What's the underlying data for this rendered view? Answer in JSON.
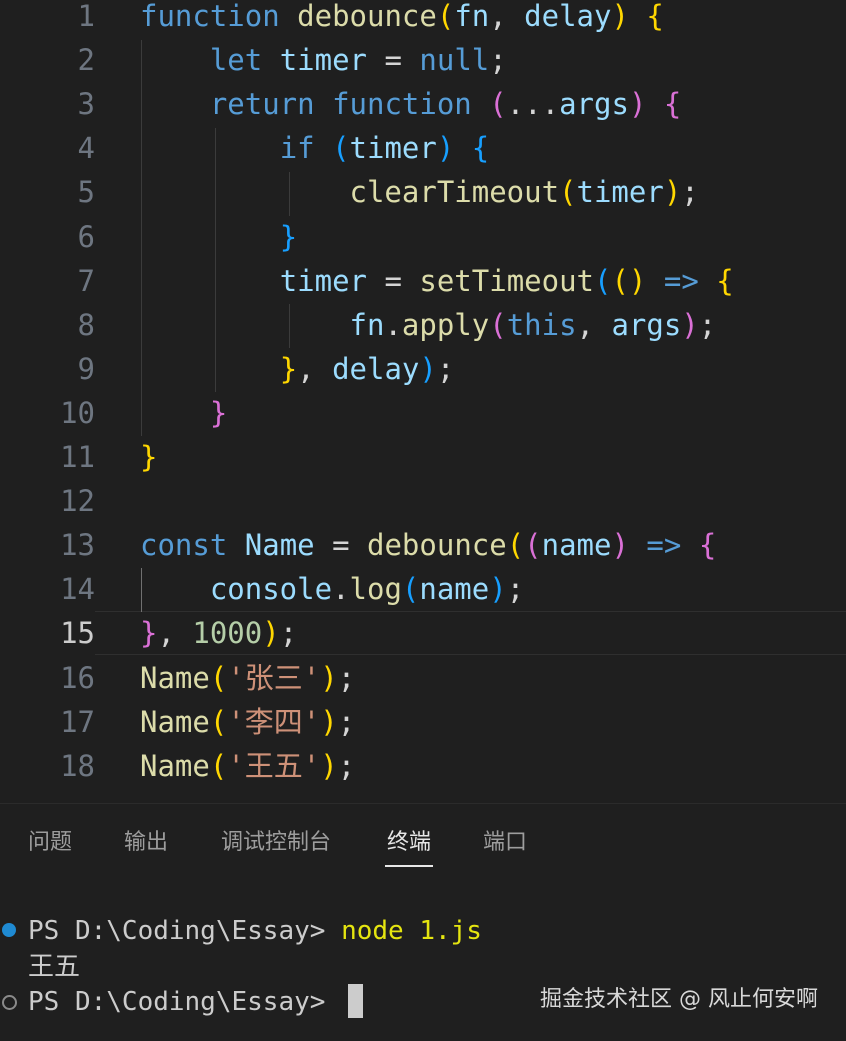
{
  "editor": {
    "line_numbers": [
      "1",
      "2",
      "3",
      "4",
      "5",
      "6",
      "7",
      "8",
      "9",
      "10",
      "11",
      "12",
      "13",
      "14",
      "15",
      "16",
      "17",
      "18"
    ],
    "active_line": "15",
    "lines": [
      [
        {
          "t": "function",
          "c": "kw"
        },
        {
          "t": " ",
          "c": "plain"
        },
        {
          "t": "debounce",
          "c": "fn"
        },
        {
          "t": "(",
          "c": "b1"
        },
        {
          "t": "fn",
          "c": "var"
        },
        {
          "t": ", ",
          "c": "plain"
        },
        {
          "t": "delay",
          "c": "var"
        },
        {
          "t": ")",
          "c": "b1"
        },
        {
          "t": " ",
          "c": "plain"
        },
        {
          "t": "{",
          "c": "b1"
        }
      ],
      [
        {
          "t": "    ",
          "c": "plain"
        },
        {
          "t": "let",
          "c": "kw"
        },
        {
          "t": " ",
          "c": "plain"
        },
        {
          "t": "timer",
          "c": "var"
        },
        {
          "t": " = ",
          "c": "op"
        },
        {
          "t": "null",
          "c": "kw"
        },
        {
          "t": ";",
          "c": "plain"
        }
      ],
      [
        {
          "t": "    ",
          "c": "plain"
        },
        {
          "t": "return",
          "c": "kw"
        },
        {
          "t": " ",
          "c": "plain"
        },
        {
          "t": "function",
          "c": "kw"
        },
        {
          "t": " ",
          "c": "plain"
        },
        {
          "t": "(",
          "c": "b2"
        },
        {
          "t": "...",
          "c": "op"
        },
        {
          "t": "args",
          "c": "var"
        },
        {
          "t": ")",
          "c": "b2"
        },
        {
          "t": " ",
          "c": "plain"
        },
        {
          "t": "{",
          "c": "b2"
        }
      ],
      [
        {
          "t": "        ",
          "c": "plain"
        },
        {
          "t": "if",
          "c": "kw"
        },
        {
          "t": " ",
          "c": "plain"
        },
        {
          "t": "(",
          "c": "b3"
        },
        {
          "t": "timer",
          "c": "var"
        },
        {
          "t": ")",
          "c": "b3"
        },
        {
          "t": " ",
          "c": "plain"
        },
        {
          "t": "{",
          "c": "b3"
        }
      ],
      [
        {
          "t": "            ",
          "c": "plain"
        },
        {
          "t": "clearTimeout",
          "c": "fn"
        },
        {
          "t": "(",
          "c": "b1"
        },
        {
          "t": "timer",
          "c": "var"
        },
        {
          "t": ")",
          "c": "b1"
        },
        {
          "t": ";",
          "c": "plain"
        }
      ],
      [
        {
          "t": "        ",
          "c": "plain"
        },
        {
          "t": "}",
          "c": "b3"
        }
      ],
      [
        {
          "t": "        ",
          "c": "plain"
        },
        {
          "t": "timer",
          "c": "var"
        },
        {
          "t": " = ",
          "c": "op"
        },
        {
          "t": "setTimeout",
          "c": "fn"
        },
        {
          "t": "(",
          "c": "b3"
        },
        {
          "t": "()",
          "c": "b1"
        },
        {
          "t": " ",
          "c": "plain"
        },
        {
          "t": "=>",
          "c": "kw"
        },
        {
          "t": " ",
          "c": "plain"
        },
        {
          "t": "{",
          "c": "b1"
        }
      ],
      [
        {
          "t": "            ",
          "c": "plain"
        },
        {
          "t": "fn",
          "c": "var"
        },
        {
          "t": ".",
          "c": "plain"
        },
        {
          "t": "apply",
          "c": "fn"
        },
        {
          "t": "(",
          "c": "b2"
        },
        {
          "t": "this",
          "c": "kw"
        },
        {
          "t": ", ",
          "c": "plain"
        },
        {
          "t": "args",
          "c": "var"
        },
        {
          "t": ")",
          "c": "b2"
        },
        {
          "t": ";",
          "c": "plain"
        }
      ],
      [
        {
          "t": "        ",
          "c": "plain"
        },
        {
          "t": "}",
          "c": "b1"
        },
        {
          "t": ", ",
          "c": "plain"
        },
        {
          "t": "delay",
          "c": "var"
        },
        {
          "t": ")",
          "c": "b3"
        },
        {
          "t": ";",
          "c": "plain"
        }
      ],
      [
        {
          "t": "    ",
          "c": "plain"
        },
        {
          "t": "}",
          "c": "b2"
        }
      ],
      [
        {
          "t": "}",
          "c": "b1"
        }
      ],
      [],
      [
        {
          "t": "const",
          "c": "kw"
        },
        {
          "t": " ",
          "c": "plain"
        },
        {
          "t": "Name",
          "c": "var"
        },
        {
          "t": " = ",
          "c": "op"
        },
        {
          "t": "debounce",
          "c": "fn"
        },
        {
          "t": "(",
          "c": "b1"
        },
        {
          "t": "(",
          "c": "b2"
        },
        {
          "t": "name",
          "c": "var"
        },
        {
          "t": ")",
          "c": "b2"
        },
        {
          "t": " ",
          "c": "plain"
        },
        {
          "t": "=>",
          "c": "kw"
        },
        {
          "t": " ",
          "c": "plain"
        },
        {
          "t": "{",
          "c": "b2"
        }
      ],
      [
        {
          "t": "    ",
          "c": "plain"
        },
        {
          "t": "console",
          "c": "var"
        },
        {
          "t": ".",
          "c": "plain"
        },
        {
          "t": "log",
          "c": "fn"
        },
        {
          "t": "(",
          "c": "b3"
        },
        {
          "t": "name",
          "c": "var"
        },
        {
          "t": ")",
          "c": "b3"
        },
        {
          "t": ";",
          "c": "plain"
        }
      ],
      [
        {
          "t": "}",
          "c": "b2"
        },
        {
          "t": ", ",
          "c": "plain"
        },
        {
          "t": "1000",
          "c": "num"
        },
        {
          "t": ")",
          "c": "b1"
        },
        {
          "t": ";",
          "c": "plain"
        }
      ],
      [
        {
          "t": "Name",
          "c": "fn"
        },
        {
          "t": "(",
          "c": "b1"
        },
        {
          "t": "'张三'",
          "c": "str"
        },
        {
          "t": ")",
          "c": "b1"
        },
        {
          "t": ";",
          "c": "plain"
        }
      ],
      [
        {
          "t": "Name",
          "c": "fn"
        },
        {
          "t": "(",
          "c": "b1"
        },
        {
          "t": "'李四'",
          "c": "str"
        },
        {
          "t": ")",
          "c": "b1"
        },
        {
          "t": ";",
          "c": "plain"
        }
      ],
      [
        {
          "t": "Name",
          "c": "fn"
        },
        {
          "t": "(",
          "c": "b1"
        },
        {
          "t": "'王五'",
          "c": "str"
        },
        {
          "t": ")",
          "c": "b1"
        },
        {
          "t": ";",
          "c": "plain"
        }
      ]
    ]
  },
  "panel": {
    "tabs": [
      "问题",
      "输出",
      "调试控制台",
      "终端",
      "端口"
    ],
    "active_tab": "终端"
  },
  "terminal": {
    "prompt1": "PS D:\\Coding\\Essay> ",
    "command1": "node 1.js",
    "output": "王五",
    "prompt2": "PS D:\\Coding\\Essay> "
  },
  "watermark": "掘金技术社区 @ 风止何安啊",
  "colors": {
    "background": "#1f1f1f",
    "keyword": "#569cd6",
    "function": "#dcdcaa",
    "variable": "#9cdcfe",
    "string": "#ce9178",
    "number": "#b5cea8",
    "bracket_gold": "#ffd700",
    "bracket_orchid": "#da70d6",
    "bracket_blue": "#179fff",
    "terminal_command": "#e5e510",
    "terminal_dot": "#1f8ad2"
  }
}
